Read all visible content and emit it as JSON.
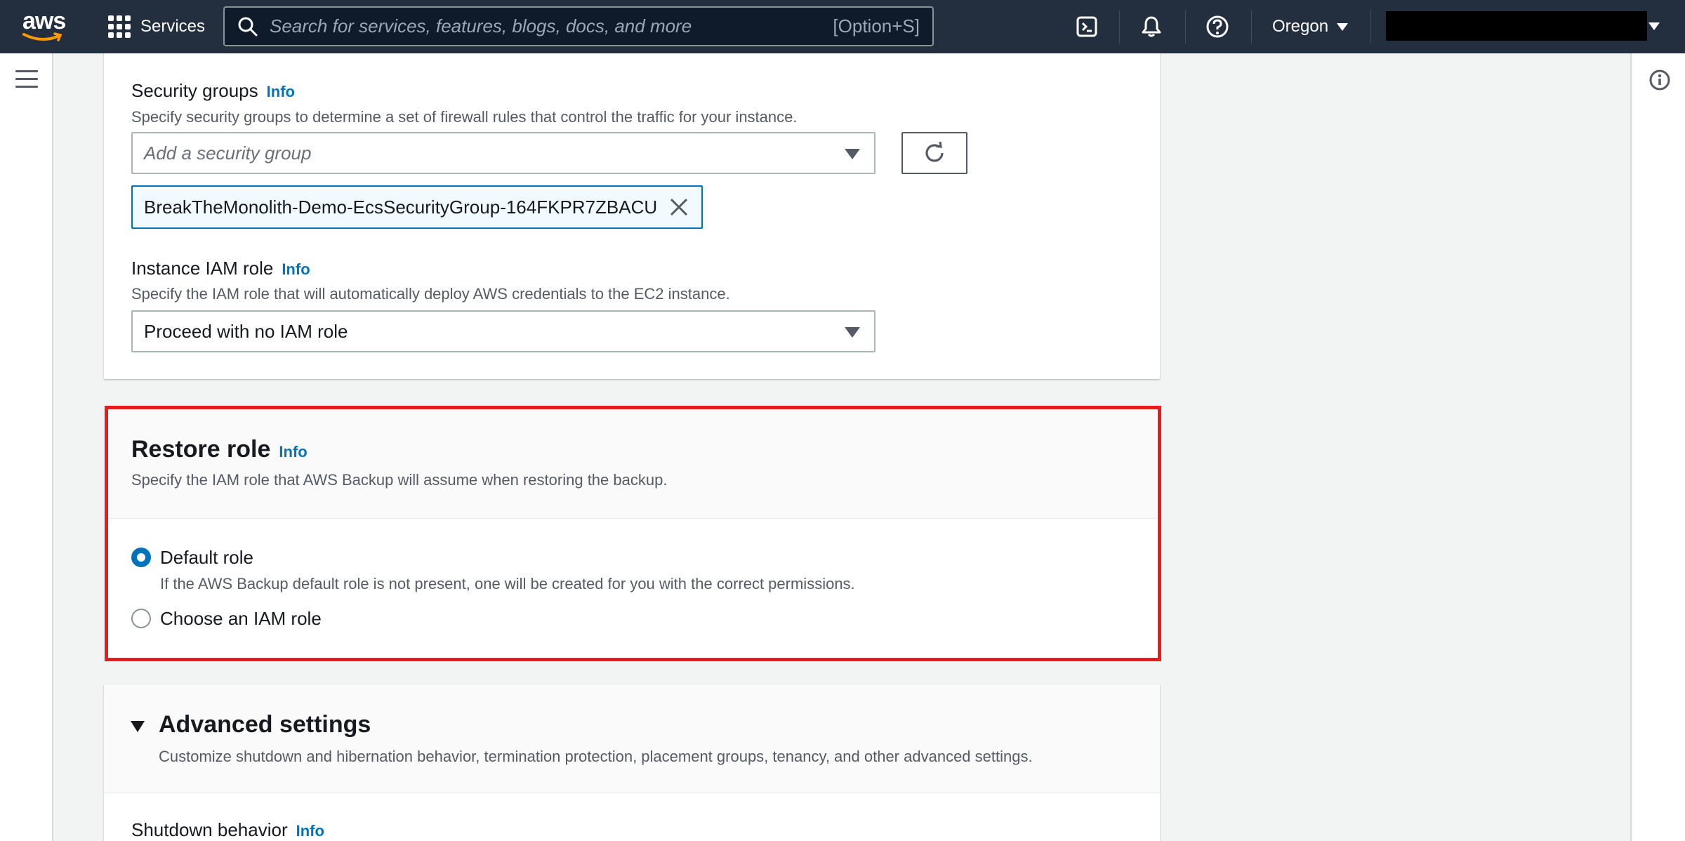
{
  "topnav": {
    "logo_text": "aws",
    "services_label": "Services",
    "search_placeholder": "Search for services, features, blogs, docs, and more",
    "search_shortcut": "[Option+S]",
    "region": "Oregon",
    "colors": {
      "background": "#232f3e",
      "accent": "#ff9900"
    }
  },
  "network": {
    "security_groups": {
      "label": "Security groups",
      "info": "Info",
      "description": "Specify security groups to determine a set of firewall rules that control the traffic for your instance.",
      "select_placeholder": "Add a security group",
      "selected_token": "BreakTheMonolith-Demo-EcsSecurityGroup-164FKPR7ZBACU"
    },
    "iam_role": {
      "label": "Instance IAM role",
      "info": "Info",
      "description": "Specify the IAM role that will automatically deploy AWS credentials to the EC2 instance.",
      "selected_value": "Proceed with no IAM role"
    }
  },
  "restore_role": {
    "title": "Restore role",
    "info": "Info",
    "description": "Specify the IAM role that AWS Backup will assume when restoring the backup.",
    "options": [
      {
        "label": "Default role",
        "description": "If the AWS Backup default role is not present, one will be created for you with the correct permissions.",
        "selected": true
      },
      {
        "label": "Choose an IAM role",
        "selected": false
      }
    ],
    "highlight_color": "#e81c1c"
  },
  "advanced_settings": {
    "title": "Advanced settings",
    "description": "Customize shutdown and hibernation behavior, termination protection, placement groups, tenancy, and other advanced settings.",
    "shutdown_label": "Shutdown behavior",
    "info": "Info"
  }
}
